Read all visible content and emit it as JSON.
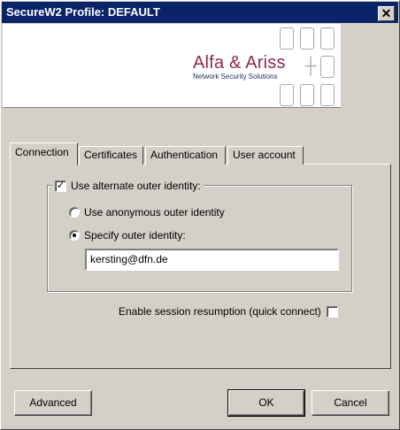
{
  "window": {
    "title": "SecureW2 Profile: DEFAULT",
    "close_glyph": "✕",
    "close_icon": "close-icon"
  },
  "banner": {
    "brand": "Alfa & Ariss",
    "tagline": "Network Security Solutions",
    "brand_color": "#8e2a45",
    "tagline_color": "#1c2f6b"
  },
  "tabs": [
    {
      "label": "Connection",
      "active": true
    },
    {
      "label": "Certificates",
      "active": false
    },
    {
      "label": "Authentication",
      "active": false
    },
    {
      "label": "User account",
      "active": false
    }
  ],
  "connection": {
    "alternate_identity": {
      "label": "Use alternate outer identity:",
      "checked": true,
      "check_glyph": "✓"
    },
    "anonymous": {
      "label": "Use anonymous outer identity",
      "selected": false
    },
    "specify": {
      "label": "Specify outer identity:",
      "selected": true
    },
    "identity_value": "kersting@dfn.de",
    "session_resumption": {
      "label": "Enable session resumption (quick connect)",
      "checked": false
    }
  },
  "buttons": {
    "advanced": "Advanced",
    "ok": "OK",
    "cancel": "Cancel"
  },
  "colors": {
    "titlebar": "#0a246a",
    "face": "#d4d0c8"
  }
}
